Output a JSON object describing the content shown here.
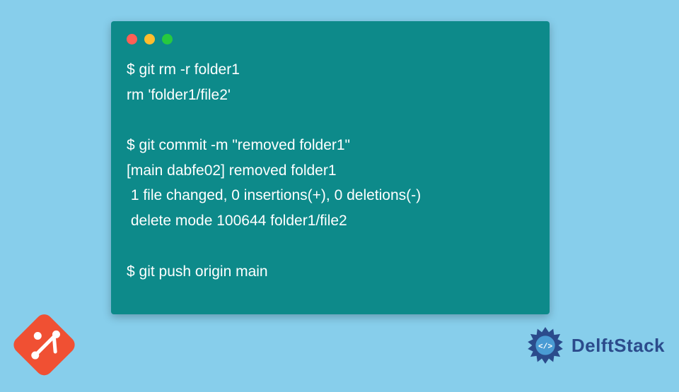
{
  "terminal": {
    "lines": [
      "$ git rm -r folder1",
      "rm 'folder1/file2'",
      "",
      "$ git commit -m \"removed folder1\"",
      "[main dabfe02] removed folder1",
      " 1 file changed, 0 insertions(+), 0 deletions(-)",
      " delete mode 100644 folder1/file2",
      "",
      "$ git push origin main"
    ]
  },
  "branding": {
    "delftstack": "DelftStack"
  }
}
